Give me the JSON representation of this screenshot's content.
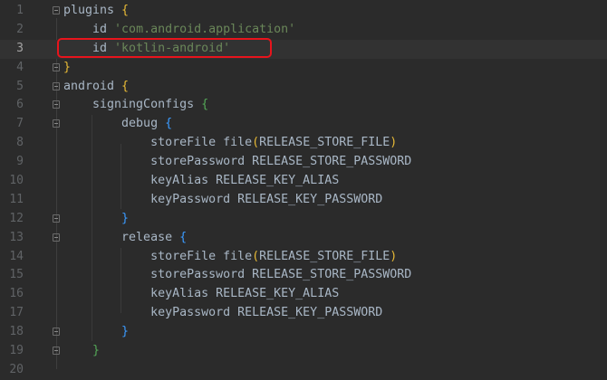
{
  "editor": {
    "lines": [
      {
        "n": "1",
        "fold": true,
        "tokens": [
          {
            "t": "plugins "
          },
          {
            "t": "{",
            "c": "b1"
          }
        ]
      },
      {
        "n": "2",
        "tokens": [
          {
            "t": "    id "
          },
          {
            "t": "'com.android.application'",
            "c": "s"
          }
        ]
      },
      {
        "n": "3",
        "current": true,
        "tokens": [
          {
            "t": "    id "
          },
          {
            "t": "'kotlin-android'",
            "c": "s"
          }
        ]
      },
      {
        "n": "4",
        "fold": true,
        "tokens": [
          {
            "t": "}",
            "c": "b1"
          }
        ]
      },
      {
        "n": "5",
        "fold": true,
        "tokens": [
          {
            "t": "android "
          },
          {
            "t": "{",
            "c": "b1"
          }
        ]
      },
      {
        "n": "6",
        "fold": true,
        "tokens": [
          {
            "t": "    signingConfigs "
          },
          {
            "t": "{",
            "c": "b2"
          }
        ]
      },
      {
        "n": "7",
        "fold": true,
        "tokens": [
          {
            "t": "        debug "
          },
          {
            "t": "{",
            "c": "b3"
          }
        ]
      },
      {
        "n": "8",
        "tokens": [
          {
            "t": "            storeFile file"
          },
          {
            "t": "(",
            "c": "p1"
          },
          {
            "t": "RELEASE_STORE_FILE"
          },
          {
            "t": ")",
            "c": "p1"
          }
        ]
      },
      {
        "n": "9",
        "tokens": [
          {
            "t": "            storePassword RELEASE_STORE_PASSWORD"
          }
        ]
      },
      {
        "n": "10",
        "tokens": [
          {
            "t": "            keyAlias RELEASE_KEY_ALIAS"
          }
        ]
      },
      {
        "n": "11",
        "tokens": [
          {
            "t": "            keyPassword RELEASE_KEY_PASSWORD"
          }
        ]
      },
      {
        "n": "12",
        "fold": true,
        "tokens": [
          {
            "t": "        "
          },
          {
            "t": "}",
            "c": "b3"
          }
        ]
      },
      {
        "n": "13",
        "fold": true,
        "tokens": [
          {
            "t": "        release "
          },
          {
            "t": "{",
            "c": "b3"
          }
        ]
      },
      {
        "n": "14",
        "tokens": [
          {
            "t": "            storeFile file"
          },
          {
            "t": "(",
            "c": "p1"
          },
          {
            "t": "RELEASE_STORE_FILE"
          },
          {
            "t": ")",
            "c": "p1"
          }
        ]
      },
      {
        "n": "15",
        "tokens": [
          {
            "t": "            storePassword RELEASE_STORE_PASSWORD"
          }
        ]
      },
      {
        "n": "16",
        "tokens": [
          {
            "t": "            keyAlias RELEASE_KEY_ALIAS"
          }
        ]
      },
      {
        "n": "17",
        "tokens": [
          {
            "t": "            keyPassword RELEASE_KEY_PASSWORD"
          }
        ]
      },
      {
        "n": "18",
        "fold": true,
        "tokens": [
          {
            "t": "        "
          },
          {
            "t": "}",
            "c": "b3"
          }
        ]
      },
      {
        "n": "19",
        "fold": true,
        "tokens": [
          {
            "t": "    "
          },
          {
            "t": "}",
            "c": "b2"
          }
        ]
      },
      {
        "n": "20",
        "tokens": []
      }
    ]
  },
  "colors": {
    "background": "#2b2b2b",
    "text": "#a9b7c6",
    "string": "#6a8759",
    "highlight_box": "#e8141c"
  }
}
